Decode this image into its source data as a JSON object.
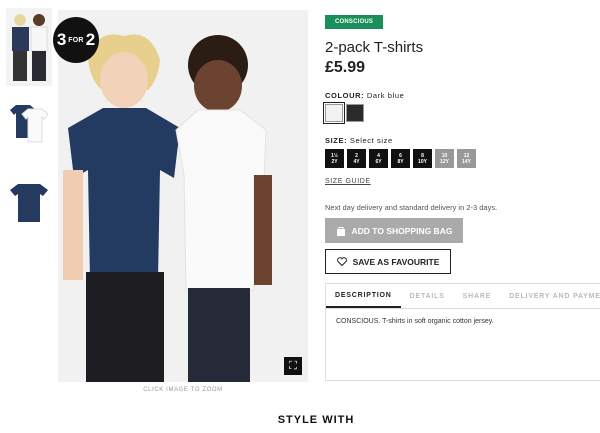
{
  "badge": {
    "big_left": "3",
    "small": "FOR",
    "big_right": "2"
  },
  "image": {
    "zoom_hint": "CLICK IMAGE TO ZOOM",
    "zoom_icon": "expand-icon"
  },
  "product": {
    "tag": "CONSCIOUS",
    "title": "2-pack T-shirts",
    "price": "£5.99",
    "colour_label": "COLOUR:",
    "colour_value": "Dark blue",
    "colours": [
      {
        "name": "white-black",
        "hex": "#f2f2f2"
      },
      {
        "name": "dark",
        "hex": "#2b2b2b"
      }
    ],
    "size_label": "SIZE:",
    "size_value": "Select size",
    "sizes": [
      {
        "top": "1½",
        "bottom": "2Y",
        "available": true
      },
      {
        "top": "2",
        "bottom": "4Y",
        "available": true
      },
      {
        "top": "4",
        "bottom": "6Y",
        "available": true
      },
      {
        "top": "6",
        "bottom": "8Y",
        "available": true
      },
      {
        "top": "8",
        "bottom": "10Y",
        "available": true
      },
      {
        "top": "10",
        "bottom": "12Y",
        "available": false
      },
      {
        "top": "12",
        "bottom": "14Y",
        "available": false
      }
    ],
    "size_guide": "SIZE GUIDE",
    "delivery": "Next day delivery and standard delivery in 2-3 days.",
    "add_to_bag": "ADD TO SHOPPING BAG",
    "save_favourite": "SAVE AS FAVOURITE"
  },
  "tabs": {
    "items": [
      "DESCRIPTION",
      "DETAILS",
      "SHARE",
      "DELIVERY AND PAYMENT"
    ],
    "active": 0,
    "content": "CONSCIOUS. T-shirts in soft organic cotton jersey."
  },
  "style_with": "STYLE WITH",
  "colors": {
    "accent_green": "#1a8f5c",
    "add_button_grey": "#aaaaaa"
  }
}
